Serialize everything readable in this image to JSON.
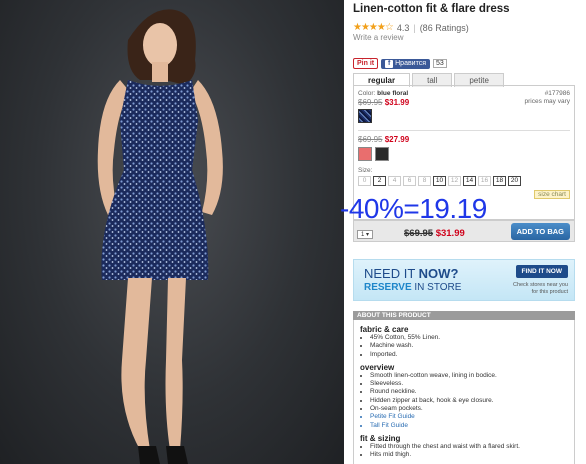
{
  "product": {
    "title": "Linen-cotton fit & flare dress",
    "stars": "★★★★☆",
    "rating": "4.3",
    "rating_sep": "|",
    "ratings_count": "(86 Ratings)",
    "write_review": "Write a review"
  },
  "share": {
    "pinit": "Pin it",
    "facebook": "Нравится",
    "facebook_count": "53"
  },
  "tabs": [
    "regular",
    "tall",
    "petite"
  ],
  "selection": {
    "color_label": "Color:",
    "color_value": "blue floral",
    "item_number": "#177986",
    "price_note": "prices may vary",
    "orig_price": "$69.95",
    "sale_price": "$31.99",
    "orig_price_2": "$69.95",
    "sale_price_2": "$27.99",
    "swatch_colors": [
      "#e96e6e",
      "#2a2a2a"
    ],
    "size_label": "Size:",
    "sizes": [
      "0",
      "2",
      "4",
      "6",
      "8",
      "10",
      "12",
      "14",
      "16",
      "18",
      "20"
    ],
    "available_sizes": [
      "2",
      "10",
      "14",
      "18",
      "20"
    ],
    "size_chart": "size chart"
  },
  "cart": {
    "qty": "1 ▾",
    "orig_price": "$69.95",
    "sale_price": "$31.99",
    "add_to_bag": "ADD TO BAG"
  },
  "overlay": "-40%=19.19",
  "promo": {
    "need": "NEED IT ",
    "now": "NOW?",
    "reserve": "RESERVE",
    "in_store": " IN STORE",
    "find_it_now": "FIND IT NOW",
    "check_line1": "Check stores near you",
    "check_line2": "for this product"
  },
  "about": {
    "header": "ABOUT THIS PRODUCT",
    "fabric_title": "fabric & care",
    "fabric": [
      "45% Cotton, 55% Linen.",
      "Machine wash.",
      "Imported."
    ],
    "overview_title": "overview",
    "overview": [
      "Smooth linen-cotton weave, lining in bodice.",
      "Sleeveless.",
      "Round neckline.",
      "Hidden zipper at back, hook & eye closure.",
      "On-seam pockets."
    ],
    "overview_links": [
      "Petite Fit Guide",
      "Tall Fit Guide"
    ],
    "fit_title": "fit & sizing",
    "fit": [
      "Fitted through the chest and waist with a flared skirt.",
      "Hits mid thigh."
    ]
  },
  "colors": {
    "overlay_blue": "#1f37e8",
    "sale_red": "#d0021b",
    "button_blue": "#2a66a3"
  }
}
